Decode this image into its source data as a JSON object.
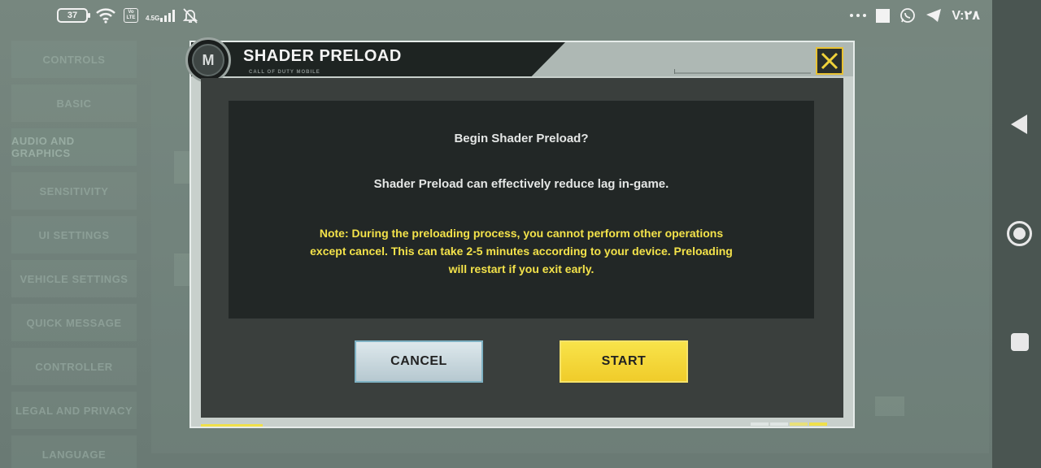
{
  "status_bar": {
    "battery": "37",
    "network": "4.5G",
    "volte": "Vo LTE",
    "time": "V:۲۸"
  },
  "background_menu": {
    "items": [
      {
        "label": "CONTROLS",
        "active": false
      },
      {
        "label": "BASIC",
        "active": false
      },
      {
        "label": "AUDIO AND GRAPHICS",
        "active": true
      },
      {
        "label": "SENSITIVITY",
        "active": false
      },
      {
        "label": "UI SETTINGS",
        "active": false
      },
      {
        "label": "VEHICLE SETTINGS",
        "active": false
      },
      {
        "label": "QUICK MESSAGE",
        "active": false
      },
      {
        "label": "CONTROLLER",
        "active": false
      },
      {
        "label": "LEGAL AND PRIVACY",
        "active": false
      },
      {
        "label": "LANGUAGE",
        "active": false
      }
    ]
  },
  "dialog": {
    "title": "SHADER PRELOAD",
    "subtitle": "CALL OF DUTY MOBILE",
    "logo_letter": "M",
    "message_title": "Begin Shader Preload?",
    "message_body": "Shader Preload can effectively reduce lag in-game.",
    "note_lines": [
      "Note: During the preloading process, you cannot perform other operations",
      "except cancel. This can take 2-5 minutes according to your device. Preloading",
      "will restart if you exit early."
    ],
    "cancel_label": "CANCEL",
    "start_label": "START"
  },
  "colors": {
    "accent_yellow": "#f0e04a",
    "note_yellow": "#f3e24a",
    "panel_dark": "#222726",
    "cancel_border": "#7fb2c4"
  },
  "icons": {
    "close": "close-x-icon",
    "wifi": "wifi-icon",
    "mute": "bell-off-icon",
    "whatsapp": "whatsapp-icon",
    "telegram": "telegram-icon",
    "nav_back": "back-triangle-icon",
    "nav_home": "home-circle-icon",
    "nav_recent": "recent-square-icon"
  }
}
